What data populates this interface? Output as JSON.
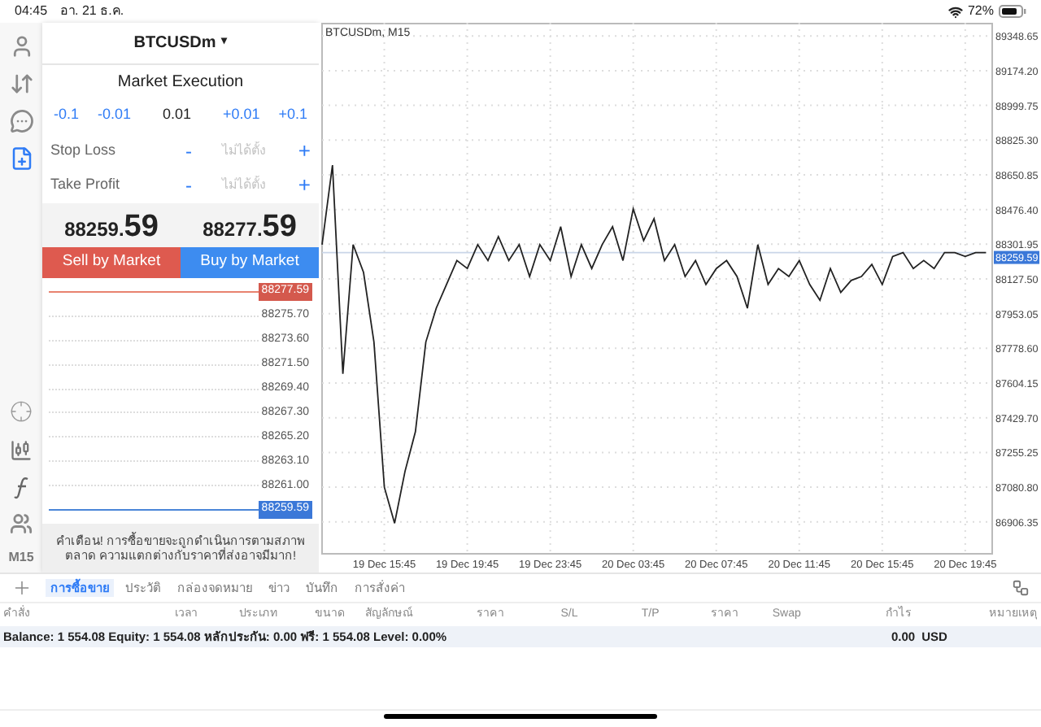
{
  "status_bar": {
    "time": "04:45",
    "date": "อา. 21 ธ.ค.",
    "battery": "72%"
  },
  "side_toolbar": {
    "top_items": [
      {
        "selected": false
      },
      {
        "selected": false
      },
      {
        "selected": false
      },
      {
        "selected": true
      }
    ],
    "timeframe": "M15"
  },
  "order_panel": {
    "symbol": "BTCUSDm",
    "caret": "▾",
    "execution": "Market Execution",
    "volume_steps": [
      {
        "label": "-0.1",
        "kind": "step"
      },
      {
        "label": "-0.01",
        "kind": "step"
      },
      {
        "label": "0.01",
        "kind": "value"
      },
      {
        "label": "+0.01",
        "kind": "step"
      },
      {
        "label": "+0.1",
        "kind": "step"
      }
    ],
    "stops": [
      {
        "label": "Stop Loss",
        "minus": "-",
        "placeholder": "ไม่ได้ตั้ง",
        "plus": "+"
      },
      {
        "label": "Take Profit",
        "minus": "-",
        "placeholder": "ไม่ได้ตั้ง",
        "plus": "+"
      }
    ],
    "bid": {
      "main": "88259.",
      "pips": "59"
    },
    "ask": {
      "main": "88277.",
      "pips": "59"
    },
    "sell_button": "Sell by Market",
    "buy_button": "Buy by Market",
    "ladder": {
      "ask": "88277.59",
      "levels": [
        "88275.70",
        "88273.60",
        "88271.50",
        "88269.40",
        "88267.30",
        "88265.20",
        "88263.10",
        "88261.00"
      ],
      "bid": "88259.59"
    },
    "warning": "คำเตือน! การซื้อขายจะถูกดำเนินการตามสภาพตลาด ความแตกต่างกับราคาที่ส่งอาจมีมาก!"
  },
  "chart": {
    "title": "BTCUSDm, M15",
    "price_label": "88259.59",
    "chart_data": {
      "type": "line",
      "categories": [
        null,
        null,
        null,
        null,
        null,
        null,
        "19 Dec 15:45",
        null,
        null,
        null,
        null,
        null,
        null,
        null,
        "19 Dec 19:45",
        null,
        null,
        null,
        null,
        null,
        null,
        null,
        "19 Dec 23:45",
        null,
        null,
        null,
        null,
        null,
        null,
        null,
        "20 Dec 03:45",
        null,
        null,
        null,
        null,
        null,
        null,
        null,
        "20 Dec 07:45",
        null,
        null,
        null,
        null,
        null,
        null,
        null,
        "20 Dec 11:45",
        null,
        null,
        null,
        null,
        null,
        null,
        null,
        "20 Dec 15:45",
        null,
        null,
        null,
        null,
        null,
        null,
        null,
        "20 Dec 19:45",
        null,
        null
      ],
      "series": [
        {
          "color": "#222222",
          "values": [
            88300,
            88700,
            87650,
            88300,
            88160,
            87810,
            87080,
            86900,
            87160,
            87360,
            87810,
            87980,
            88100,
            88220,
            88180,
            88300,
            88220,
            88340,
            88220,
            88300,
            88140,
            88300,
            88220,
            88390,
            88140,
            88300,
            88180,
            88300,
            88390,
            88220,
            88480,
            88320,
            88430,
            88220,
            88300,
            88140,
            88220,
            88100,
            88180,
            88220,
            88140,
            87980,
            88300,
            88100,
            88180,
            88140,
            88220,
            88100,
            88020,
            88180,
            88060,
            88120,
            88140,
            88200,
            88100,
            88240,
            88260,
            88180,
            88220,
            88180,
            88260,
            88260,
            88240,
            88260,
            88260
          ]
        },
        {
          "color": "#c9d6e8",
          "values": [
            88260,
            88260,
            88260,
            88260,
            88260,
            88260,
            88260,
            88260,
            88260,
            88260,
            88260,
            88260,
            88260,
            88260,
            88260,
            88260,
            88260,
            88260,
            88260,
            88260,
            88260,
            88260,
            88260,
            88260,
            88260,
            88260,
            88260,
            88260,
            88260,
            88260,
            88260,
            88260,
            88260,
            88260,
            88260,
            88260,
            88260,
            88260,
            88260,
            88260,
            88260,
            88260,
            88260,
            88260,
            88260,
            88260,
            88260,
            88260,
            88260,
            88260,
            88260,
            88260,
            88260,
            88260,
            88260,
            88260,
            88260,
            88260,
            88260,
            88260,
            88260,
            88260,
            88260,
            88260,
            88260
          ]
        }
      ],
      "ylim": [
        86750,
        89415
      ],
      "yticks": [
        {
          "value": 89348.65,
          "label": "89348.65"
        },
        {
          "value": 89174.2,
          "label": "89174.20"
        },
        {
          "value": 88999.75,
          "label": "88999.75"
        },
        {
          "value": 88825.3,
          "label": "88825.30"
        },
        {
          "value": 88650.85,
          "label": "88650.85"
        },
        {
          "value": 88476.4,
          "label": "88476.40"
        },
        {
          "value": 88301.95,
          "label": "88301.95"
        },
        {
          "value": 88127.5,
          "label": "88127.50"
        },
        {
          "value": 87953.05,
          "label": "87953.05"
        },
        {
          "value": 87778.6,
          "label": "87778.60"
        },
        {
          "value": 87604.15,
          "label": "87604.15"
        },
        {
          "value": 87429.7,
          "label": "87429.70"
        },
        {
          "value": 87255.25,
          "label": "87255.25"
        },
        {
          "value": 87080.8,
          "label": "87080.80"
        },
        {
          "value": 86906.35,
          "label": "86906.35"
        }
      ],
      "grid": true
    }
  },
  "bottom_tabs": [
    {
      "label": "การซื้อขาย",
      "selected": true
    },
    {
      "label": "ประวัติ",
      "selected": false
    },
    {
      "label": "กล่องจดหมาย",
      "selected": false
    },
    {
      "label": "ข่าว",
      "selected": false
    },
    {
      "label": "บันทึก",
      "selected": false
    },
    {
      "label": "การสั่งค่า",
      "selected": false
    }
  ],
  "table": {
    "columns": [
      "คำสั่ง",
      "เวลา",
      "ประเภท",
      "ขนาด",
      "สัญลักษณ์",
      "ราคา",
      "S/L",
      "T/P",
      "ราคา",
      "Swap",
      "กำไร",
      "หมายเหตุ"
    ]
  },
  "summary": {
    "text": "Balance: 1 554.08 Equity: 1 554.08 หลักประกัน: 0.00 ฟรี: 1 554.08 Level: 0.00%",
    "profit": "0.00",
    "currency": "USD"
  }
}
